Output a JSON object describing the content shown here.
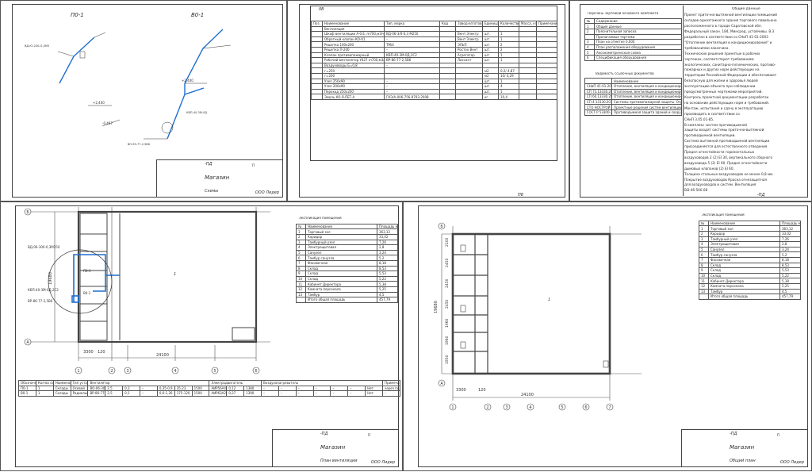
{
  "common": {
    "project_code": "-ПД",
    "object": "Магазин",
    "organization": "ООО Лидер",
    "stage": "П",
    "sheet_one": "1"
  },
  "sheet_schemes": {
    "label_p1": "П0-1",
    "label_v1": "В0-1",
    "stamp_title": "Схемы",
    "tags": [
      "ВД-Ю-200-I2,4М3",
      "КВП-40-3М-0Д",
      "ВП-99-77-2,5В6",
      "+2,400",
      "+2,400",
      "-0,467"
    ]
  },
  "sheet_spec": {
    "title": "0В",
    "headers": [
      "Поз.",
      "Наименование",
      "Тип, марка",
      "Код",
      "Завод-изготовитель",
      "Единица изм.",
      "Количество",
      "Масса, кг",
      "Примечание"
    ],
    "section": "Вентиляция",
    "rows": [
      [
        "",
        "Вентиляция",
        "",
        "",
        "",
        "",
        "",
        "",
        ""
      ],
      [
        "",
        "Шкаф вентиляции А-0.Е, m700,м3/ч",
        "ВД-06-3/0-0,3 М250",
        "",
        "Вент.Электр",
        "шт.",
        "1",
        "",
        ""
      ],
      [
        "",
        "Обратный клапан КО-01",
        "–",
        "",
        "Вент.Электр",
        "шт.",
        "1",
        "",
        ""
      ],
      [
        "",
        "Решетка 100x200",
        "ТМ/4",
        "",
        "ЭЛЬП",
        "шт.",
        "2",
        "",
        ""
      ],
      [
        "",
        "Решетка П-200",
        "–",
        "",
        "Ростех Вент",
        "шт.",
        "2",
        "",
        ""
      ],
      [
        "",
        "Клапан противопожарный",
        "КВП-40-3М-0Д,2С2",
        "",
        "Агрегатор",
        "шт.",
        "1",
        "",
        ""
      ],
      [
        "",
        "Рабочий вентилятор У427 m700,м3/ч",
        "ВР-86-77-2,5В6",
        "",
        "Лиссант",
        "шт.",
        "1",
        "",
        ""
      ],
      [
        "",
        "Воздуховоды Б=0,8",
        "–",
        "",
        "",
        "",
        "",
        "",
        ""
      ],
      [
        "",
        "г=250",
        "",
        "",
        "",
        "м2",
        "0,2/ 4,87",
        "",
        ""
      ],
      [
        "",
        "г=200",
        "",
        "",
        "",
        "м2",
        "10/ 4,29",
        "",
        ""
      ],
      [
        "",
        "Узел 250х90",
        "–",
        "",
        "",
        "шт.",
        "1",
        "",
        ""
      ],
      [
        "",
        "Узел 200х90",
        "–",
        "",
        "",
        "шт.",
        "4",
        "",
        ""
      ],
      [
        "",
        "Переход 250х200",
        "–",
        "",
        "",
        "шт.",
        "1",
        "",
        ""
      ],
      [
        "",
        "Эмаль КО-Я-ПЕТ-А",
        "ГКЭ/А-006-756-9793-2008",
        "",
        "",
        "кг.",
        "10,4",
        "",
        ""
      ]
    ],
    "stamp_title": "П8"
  },
  "sheet_list": {
    "title1": "Перечень чертежей основного комплекта",
    "headers1": [
      "№",
      "Содержание"
    ],
    "rows1": [
      [
        "1",
        "Общие данные"
      ],
      [
        "2",
        "Пояснительная записка"
      ],
      [
        "",
        "Прилагаемые чертежи"
      ],
      [
        "3",
        "План на отметке 0,000"
      ],
      [
        "4",
        "План расположения оборудования"
      ],
      [
        "5",
        "Аксонометрическая схема"
      ],
      [
        "6",
        "Спецификация оборудования"
      ]
    ],
    "title2": "Ведомость ссылочных документов",
    "headers2": [
      "",
      "Наименование"
    ],
    "rows2": [
      [
        "СНиП 41-01-2003",
        "Отопление, вентиляция и кондиционирование"
      ],
      [
        "СП 73.13330.2016",
        "Отопление, вентиляция и кондиционирование. Противопожарные требования"
      ],
      [
        "СП 60.13330.2020",
        "Отопление, вентиляция и кондиционирование воздуха"
      ],
      [
        "СП 4.13130.2013",
        "Системы противопожарной защиты. Ограничение распространения пожара"
      ],
      [
        "СТО НОСТРОЙ 2.23.97",
        "Проектные решения систем вентиляции"
      ],
      [
        "ГОСТ Р 53300-2009",
        "Противодымная защита зданий и сооружений"
      ]
    ],
    "general_title": "Общие данные",
    "general_text": [
      "Проект приточно-вытяжной вентиляции помещений",
      "складов одноэтажного здания торгового павильона",
      "расположенного в городе Саратовской обл.",
      "Федеральный закон. 184, Минсред, устойчивы. В.3",
      "разработан в соответствии со СНиП 41-01-2003",
      "\"Отопление вентиляция и кондиционирование\" и",
      "требованиями заказчика.",
      "Технические решения принятые в рабочих",
      "чертежах, соответствуют требованиям",
      "экологических, санитарно-гигиенических, противо-",
      "пожарных и других норм действующих на",
      "территории Российской Федерации и обеспечивают",
      "безопасную для жизни и здоровья людей",
      "эксплуатацию объекта при соблюдении",
      "предусмотренных чертежами мероприятий.",
      "Контроль проектной документации разработан",
      "на основании действующих норм и требований.",
      "Монтаж, испытания и сдачу в эксплуатацию",
      "производить в соответствии со",
      "СНиП 3.05.01-85.",
      "В комплекс систем противодымной",
      "защиты входят системы приточно-вытяжной",
      "противодымной вентиляции.",
      "Система вытяжной противодымной вентиляции",
      "присоединяется для естественного отведения.",
      "Предел огнестойкости горизонтальных",
      "воздуховодов 2 (2) EI 30, вертикального сборного",
      "воздуховода 5 (2) EI 60. Предел огнестойкости",
      "дымовых клапанов (2) EI 60.",
      "Толщина стальных воздуховодов не менее 0,8 мм.",
      "Покрытие воздуховодов Краска огнезащитная",
      "для воздуховодов и систем. Вентиляция",
      "ВД-46-500.08"
    ],
    "stamp_title": "-ПД"
  },
  "sheet_plan": {
    "expl_title": "Экспликация помещений",
    "expl_headers": [
      "№",
      "Наименование",
      "Площадь м2"
    ],
    "expl_rows": [
      [
        "1",
        "Торговый зал",
        "363,12"
      ],
      [
        "2",
        "Коридор",
        "33,02"
      ],
      [
        "3",
        "Тамбурный узел",
        "7,26"
      ],
      [
        "4",
        "Электрощитовая",
        "2,8"
      ],
      [
        "5",
        "Санузел",
        "3,24"
      ],
      [
        "6",
        "Тамбур санузла",
        "5,2"
      ],
      [
        "7",
        "Фасовочная",
        "8,18"
      ],
      [
        "8",
        "Склад",
        "8,53"
      ],
      [
        "9",
        "Склад",
        "5,53"
      ],
      [
        "10",
        "Склад",
        "5,22"
      ],
      [
        "11",
        "Кабинет Директора",
        "5,38"
      ],
      [
        "12",
        "Комната персонала",
        "5,25"
      ],
      [
        "13",
        "Тамбур",
        "4,5"
      ]
    ],
    "expl_total": "Итого общая площадь",
    "expl_total_value": "457,79",
    "dim_total": "24100",
    "dim_left": "3300",
    "dim_gap": "120",
    "dim_height": "19680",
    "equip_headers": [
      "Обозначение системы",
      "Кол-во систем",
      "Наименование обслуживаемого помещения",
      "Тип установки",
      "Вентилятор",
      "Электродвигатель",
      "Воздухонагреватель",
      "Примечание"
    ],
    "equip_rows": [
      [
        "П0-1",
        "1",
        "Склады",
        "Осевой",
        "ВО-06-300",
        "2,5",
        "0,3",
        "–",
        "0,35-0,9",
        "35-23",
        "1500",
        "АИР56А4",
        "0,12",
        "1380",
        "–",
        "–",
        "–",
        "–",
        "–",
        "–",
        "Нет",
        "через поддон"
      ],
      [
        "В0-1",
        "1",
        "Склады",
        "Радиальный",
        "ВР-86-77-2,5",
        "2,5",
        "0,1",
        "–",
        "0,6-1,26",
        "175-120",
        "1500",
        "АИР63А2",
        "0,37",
        "1390",
        "–",
        "–",
        "–",
        "–",
        "–",
        "–",
        "Нет",
        "–"
      ]
    ],
    "stamp_title": "План вентиляции",
    "tags": [
      "ВД-06-300-0,3М250",
      "КВП-40-3М-0Д,2С2",
      "ВР-86-77-2,5В6",
      "П0-1",
      "В0-1"
    ]
  },
  "sheet_general": {
    "expl_title": "Экспликация помещений",
    "stamp_title": "Общий план",
    "dims_left": [
      "2100",
      "2450",
      "2450",
      "2450",
      "1960",
      "1960",
      "1950"
    ],
    "dim_total": "24100",
    "dim_left": "3300",
    "dim_gap": "120",
    "dim_height": "19680"
  },
  "axis_letters": [
    "Б",
    "А"
  ],
  "axis_numbers": [
    "1",
    "2",
    "3",
    "4",
    "5",
    "6",
    "7",
    "8"
  ]
}
